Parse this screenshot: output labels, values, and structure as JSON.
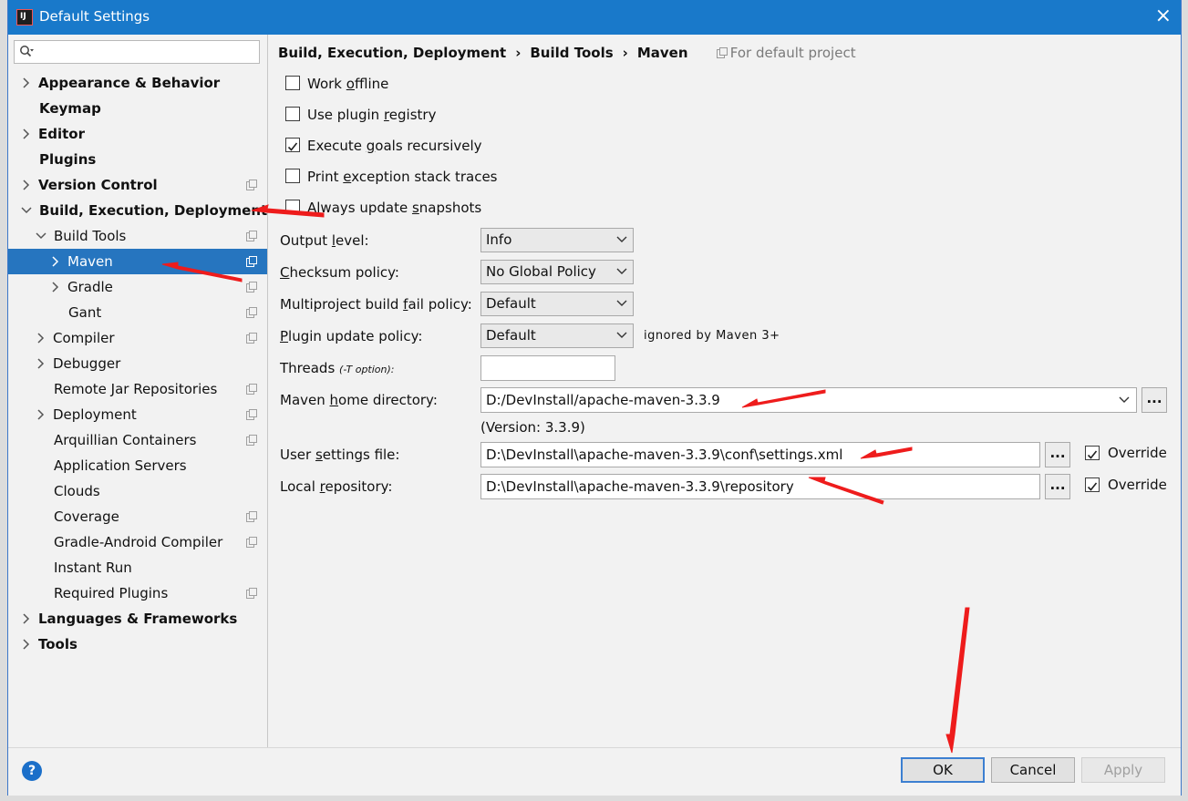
{
  "window": {
    "title": "Default Settings",
    "close": "×",
    "app_icon": "IJ"
  },
  "sidebar": {
    "search_placeholder": "",
    "items": [
      {
        "label": "Appearance & Behavior"
      },
      {
        "label": "Keymap"
      },
      {
        "label": "Editor"
      },
      {
        "label": "Plugins"
      },
      {
        "label": "Version Control"
      },
      {
        "label": "Build, Execution, Deployment"
      },
      {
        "label": "Build Tools"
      },
      {
        "label": "Maven"
      },
      {
        "label": "Gradle"
      },
      {
        "label": "Gant"
      },
      {
        "label": "Compiler"
      },
      {
        "label": "Debugger"
      },
      {
        "label": "Remote Jar Repositories"
      },
      {
        "label": "Deployment"
      },
      {
        "label": "Arquillian Containers"
      },
      {
        "label": "Application Servers"
      },
      {
        "label": "Clouds"
      },
      {
        "label": "Coverage"
      },
      {
        "label": "Gradle-Android Compiler"
      },
      {
        "label": "Instant Run"
      },
      {
        "label": "Required Plugins"
      },
      {
        "label": "Languages & Frameworks"
      },
      {
        "label": "Tools"
      }
    ]
  },
  "breadcrumb": {
    "parts": [
      "Build, Execution, Deployment",
      "Build Tools",
      "Maven"
    ],
    "separator": "›",
    "scope": "For default project"
  },
  "checkboxes": [
    {
      "pre": "Work ",
      "u": "o",
      "post": "ffline",
      "checked": false
    },
    {
      "pre": "Use plugin ",
      "u": "r",
      "post": "egistry",
      "checked": false
    },
    {
      "pre": "Execute ",
      "u": "g",
      "post": "oals recursively",
      "checked": true
    },
    {
      "pre": "Print ",
      "u": "e",
      "post": "xception stack traces",
      "checked": false
    },
    {
      "pre": "Always update ",
      "u": "s",
      "post": "napshots",
      "checked": false
    }
  ],
  "form": {
    "output_level": {
      "pre": "Output ",
      "u": "l",
      "post": "evel:",
      "value": "Info"
    },
    "checksum_policy": {
      "pre": "",
      "u": "C",
      "post": "hecksum policy:",
      "value": "No Global Policy"
    },
    "multiproject_policy": {
      "pre": "Multiproject build ",
      "u": "f",
      "post": "ail policy:",
      "value": "Default"
    },
    "plugin_update_policy": {
      "pre": "",
      "u": "P",
      "post": "lugin update policy:",
      "value": "Default",
      "hint": "ignored by Maven 3+"
    },
    "threads": {
      "label": "Threads ",
      "hint": "(-T option):",
      "value": ""
    },
    "maven_home": {
      "pre": "Maven ",
      "u": "h",
      "post": "ome directory:",
      "value": "D:/DevInstall/apache-maven-3.3.9",
      "version": "(Version: 3.3.9)"
    },
    "user_settings": {
      "pre": "User ",
      "u": "s",
      "post": "ettings file:",
      "value": "D:\\DevInstall\\apache-maven-3.3.9\\conf\\settings.xml",
      "override": "Override"
    },
    "local_repo": {
      "pre": "Local ",
      "u": "r",
      "post": "epository:",
      "value": "D:\\DevInstall\\apache-maven-3.3.9\\repository",
      "override": "Override"
    },
    "browse": "..."
  },
  "footer": {
    "help": "?",
    "ok": "OK",
    "cancel": "Cancel",
    "apply": "Apply"
  },
  "colors": {
    "titlebar": "#1979ca",
    "selection": "#2675bf",
    "annotation": "#ee1c1c"
  }
}
